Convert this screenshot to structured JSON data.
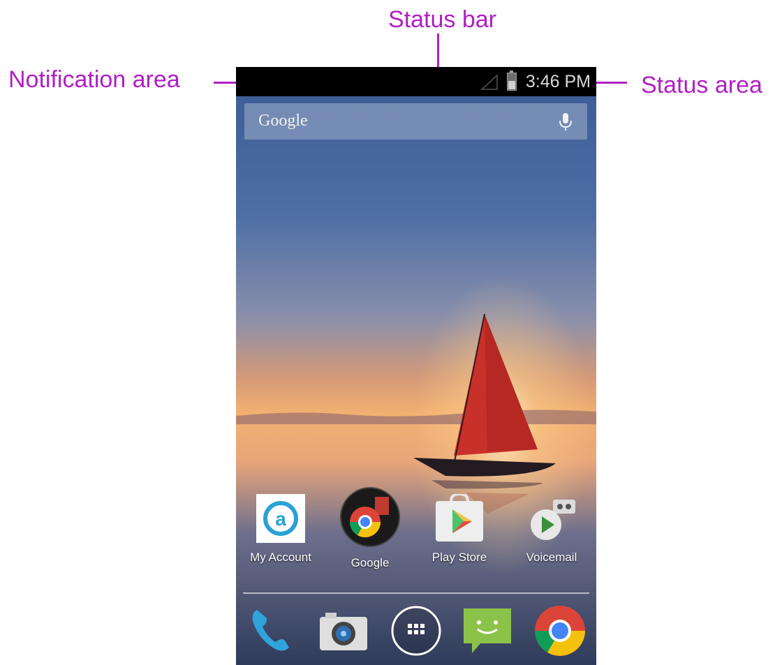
{
  "callouts": {
    "status_bar": "Status bar",
    "notification_area": "Notification area",
    "status_area": "Status area"
  },
  "status_bar": {
    "time": "3:46 PM",
    "icons": [
      "signal-icon",
      "battery-icon"
    ]
  },
  "search": {
    "label": "Google",
    "icon": "microphone-icon"
  },
  "apps": [
    {
      "label": "My Account",
      "icon": "my-account-icon"
    },
    {
      "label": "Google",
      "icon": "google-folder-icon"
    },
    {
      "label": "Play Store",
      "icon": "play-store-icon"
    },
    {
      "label": "Voicemail",
      "icon": "voicemail-icon"
    }
  ],
  "dock": [
    "phone-icon",
    "camera-icon",
    "app-drawer-icon",
    "messaging-icon",
    "chrome-icon"
  ],
  "colors": {
    "callout": "#b01fc4",
    "status_bar": "#000000",
    "sail": "#c8302a"
  }
}
